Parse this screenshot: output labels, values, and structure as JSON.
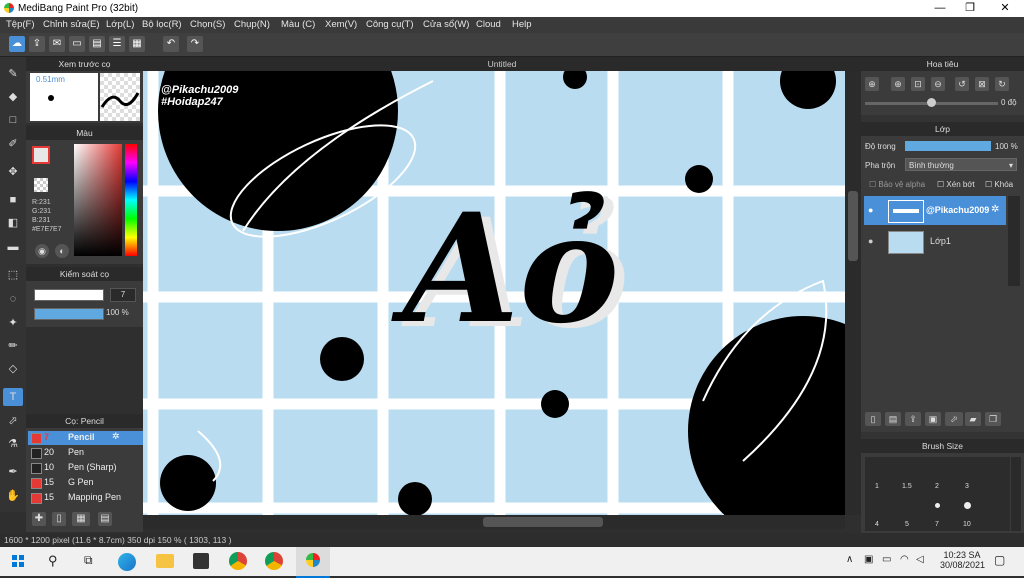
{
  "window": {
    "title": "MediBang Paint Pro (32bit)",
    "min": "—",
    "max": "❐",
    "close": "✕"
  },
  "menu": [
    "Tệp(F)",
    "Chỉnh sửa(E)",
    "Lớp(L)",
    "Bộ lọc(R)",
    "Chọn(S)",
    "Chụp(N)",
    "Màu (C)",
    "Xem(V)",
    "Công cụ(T)",
    "Cửa sổ(W)",
    "Cloud",
    "Help"
  ],
  "canvas": {
    "tab_title": "Untitled",
    "watermark_line1": "@Pikachu2009",
    "watermark_line2": "#Hoidap247",
    "art_text": "Aỏ"
  },
  "preview_panel": {
    "title": "Xem trước cọ",
    "size_label": "0.51mm"
  },
  "color_panel": {
    "title": "Màu",
    "r": "R:231",
    "g": "G:231",
    "b": "B:231",
    "hex": "#E7E7E7",
    "fg_color": "#e7e7e7"
  },
  "brush_control": {
    "title": "Kiểm soát cọ",
    "size_value": "7",
    "opacity_value": "100 %"
  },
  "brush_list": {
    "title": "Cọ: Pencil",
    "items": [
      {
        "size": "7",
        "name": "Pencil",
        "color": "#e53935",
        "selected": true
      },
      {
        "size": "20",
        "name": "Pen",
        "color": "#222222",
        "selected": false
      },
      {
        "size": "10",
        "name": "Pen (Sharp)",
        "color": "#222222",
        "selected": false
      },
      {
        "size": "15",
        "name": "G Pen",
        "color": "#e53935",
        "selected": false
      },
      {
        "size": "15",
        "name": "Mapping Pen",
        "color": "#e53935",
        "selected": false
      }
    ]
  },
  "navigator": {
    "title": "Hoa tiêu",
    "rotation": "0 độ"
  },
  "layer_panel": {
    "title": "Lớp",
    "opacity_label": "Độ trong",
    "opacity_value": "100 %",
    "blend_label": "Pha trộn",
    "blend_value": "Bình thường",
    "protect_alpha": "Bảo vệ alpha",
    "clipping": "Xén bớt",
    "lock": "Khóa",
    "layers": [
      {
        "name": "@Pikachu2009",
        "selected": true
      },
      {
        "name": "Lớp1",
        "selected": false
      }
    ]
  },
  "brush_size": {
    "title": "Brush Size",
    "row1": [
      "1",
      "1.5",
      "2",
      "3"
    ],
    "row2": [
      "4",
      "5",
      "7",
      "10"
    ]
  },
  "status": {
    "text": "1600 * 1200 pixel   (11.6 * 8.7cm)   350 dpi   150 %   ( 1303, 113 )"
  },
  "taskbar": {
    "time": "10:23 SA",
    "date": "30/08/2021"
  },
  "colors": {
    "accent": "#4a90d9",
    "canvas_bg": "#b9dcf1"
  }
}
